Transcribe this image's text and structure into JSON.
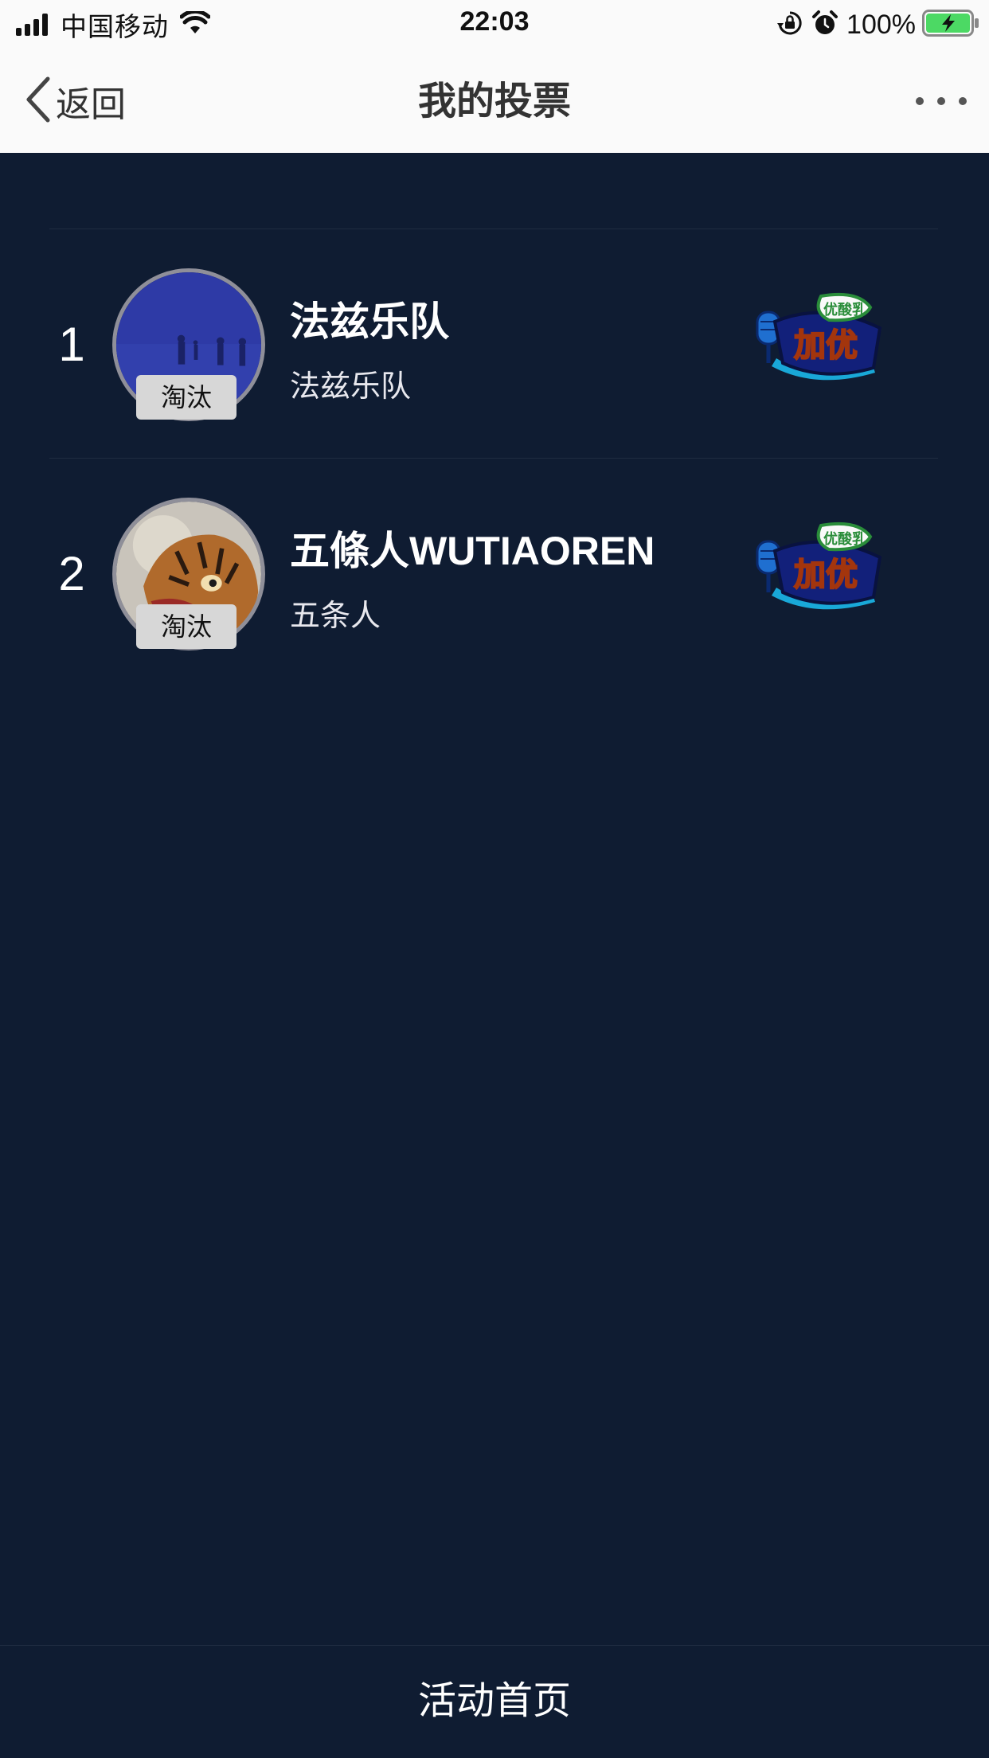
{
  "status_bar": {
    "carrier": "中国移动",
    "time": "22:03",
    "battery": "100%"
  },
  "nav": {
    "back_label": "返回",
    "title": "我的投票"
  },
  "items": [
    {
      "rank": "1",
      "name": "法兹乐队",
      "subtitle": "法兹乐队",
      "tag": "淘汰",
      "sponsor": "优酸乳 加优"
    },
    {
      "rank": "2",
      "name": "五條人WUTIAOREN",
      "subtitle": "五条人",
      "tag": "淘汰",
      "sponsor": "优酸乳 加优"
    }
  ],
  "footer": {
    "home_label": "活动首页"
  },
  "icons": {
    "signal": "signal-icon",
    "wifi": "wifi-icon",
    "rotation_lock": "rotation-lock-icon",
    "alarm": "alarm-icon",
    "battery": "battery-icon",
    "back": "chevron-left-icon",
    "more": "more-icon"
  },
  "colors": {
    "background": "#0f1c32",
    "header_background": "#fafafa",
    "tag_background": "#d7d7d7",
    "battery_fill": "#4cd964"
  }
}
